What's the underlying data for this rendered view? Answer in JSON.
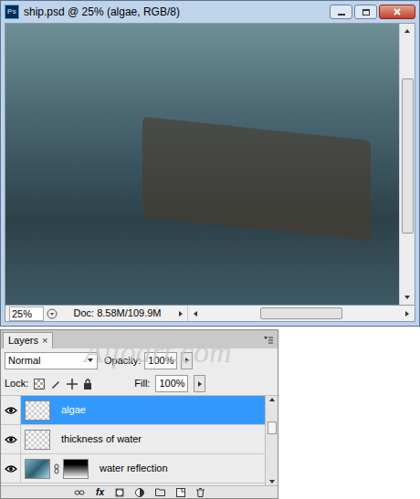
{
  "window": {
    "title": "ship.psd @ 25% (algae, RGB/8)",
    "app_icon": "Ps"
  },
  "status_bar": {
    "zoom": "25%",
    "doc": "Doc: 8.58M/109.9M"
  },
  "layers_panel": {
    "tab": "Layers",
    "close": "×",
    "blend_mode": "Normal",
    "opacity_label": "Opacity:",
    "opacity": "100%",
    "lock_label": "Lock:",
    "fill_label": "Fill:",
    "fill": "100%",
    "layers": [
      {
        "name": "algae",
        "selected": true,
        "visible": true,
        "kind": "plain"
      },
      {
        "name": "thickness of water",
        "selected": false,
        "visible": true,
        "kind": "plain"
      },
      {
        "name": "water reflection",
        "selected": false,
        "visible": true,
        "kind": "masked"
      }
    ],
    "footer_fx": "fx"
  },
  "watermark": "Alfoart.com"
}
